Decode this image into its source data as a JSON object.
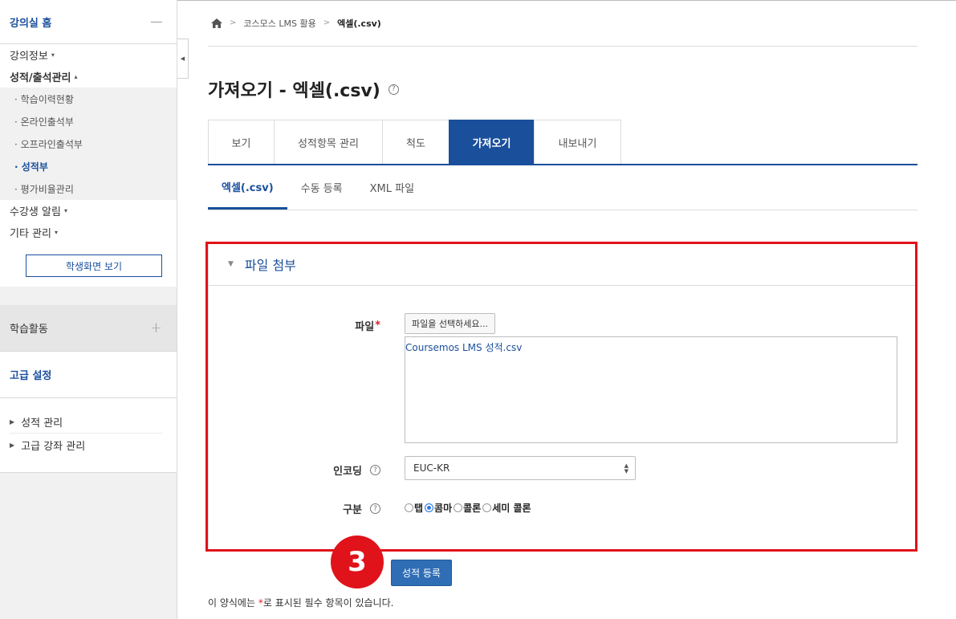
{
  "sidebar": {
    "home_label": "강의실 홈",
    "menu": [
      {
        "label": "강의정보",
        "caret": "▾"
      },
      {
        "label": "성적/출석관리",
        "caret": "▴"
      }
    ],
    "sub_items": [
      {
        "label": "· 학습이력현황"
      },
      {
        "label": "· 온라인출석부"
      },
      {
        "label": "· 오프라인출석부"
      },
      {
        "label": "· 성적부"
      },
      {
        "label": "· 평가비율관리"
      }
    ],
    "menu_after": [
      {
        "label": "수강생 알림",
        "caret": "▾"
      },
      {
        "label": "기타 관리",
        "caret": "▾"
      }
    ],
    "student_view_button": "학생화면 보기",
    "activity_label": "학습활동",
    "activity_plus": "+",
    "advanced_title": "고급 설정",
    "advanced_items": [
      {
        "label": "성적 관리"
      },
      {
        "label": "고급 강좌 관리"
      }
    ]
  },
  "breadcrumb": {
    "items": [
      "코스모스 LMS 활용",
      "엑셀(.csv)"
    ],
    "separator": ">"
  },
  "page": {
    "title": "가져오기 - 엑셀(.csv)",
    "help_glyph": "?"
  },
  "tabs": [
    {
      "label": "보기"
    },
    {
      "label": "성적항목 관리"
    },
    {
      "label": "척도"
    },
    {
      "label": "가져오기"
    },
    {
      "label": "내보내기"
    }
  ],
  "subtabs": [
    {
      "label": "엑셀(.csv)"
    },
    {
      "label": "수동 등록"
    },
    {
      "label": "XML 파일"
    }
  ],
  "form": {
    "section_title": "파일 첨부",
    "file_label": "파일",
    "required_mark": "*",
    "file_picker_button": "파일을 선택하세요...",
    "file_name": "Coursemos LMS 성적.csv",
    "encoding_label": "인코딩",
    "encoding_value": "EUC-KR",
    "separator_label": "구분",
    "separator_options": [
      "탭",
      "콤마",
      "콜론",
      "세미 콜론"
    ],
    "separator_selected": "콤마"
  },
  "submit_button": "성적 등록",
  "step_badge": "3",
  "footnote": {
    "before": "이 양식에는 ",
    "mark": "*",
    "after": "로 표시된 필수 항목이 있습니다."
  },
  "colors": {
    "accent": "#1a4f9c",
    "highlight": "#e0121a",
    "button": "#2f6db5"
  }
}
